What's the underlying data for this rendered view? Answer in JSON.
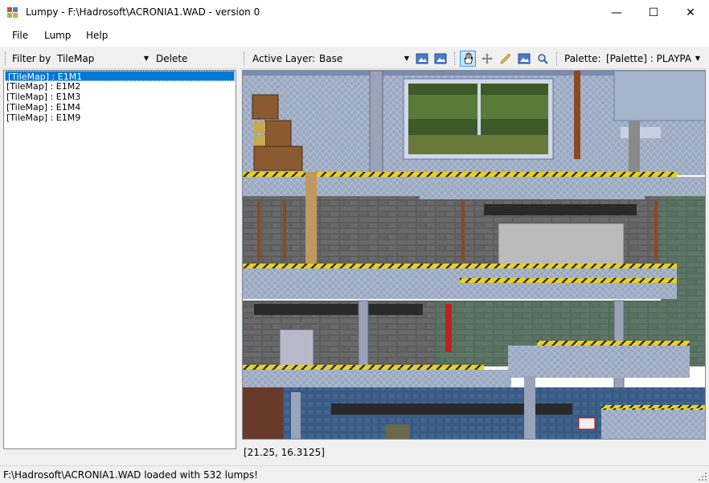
{
  "window": {
    "title": "Lumpy - F:\\Hadrosoft\\ACRONIA1.WAD - version 0",
    "minimize_glyph": "—",
    "maximize_glyph": "☐",
    "close_glyph": "✕"
  },
  "menu": {
    "items": [
      "File",
      "Lump",
      "Help"
    ]
  },
  "filter": {
    "label": "Filter by",
    "value": "TileMap",
    "delete_label": "Delete"
  },
  "lumps": [
    {
      "label": "[TileMap] : E1M1",
      "selected": true
    },
    {
      "label": "[TileMap] : E1M2",
      "selected": false
    },
    {
      "label": "[TileMap] : E1M3",
      "selected": false
    },
    {
      "label": "[TileMap] : E1M4",
      "selected": false
    },
    {
      "label": "[TileMap] : E1M9",
      "selected": false
    }
  ],
  "editor": {
    "active_layer_label": "Active Layer:",
    "active_layer_value": "Base",
    "palette_label": "Palette:",
    "palette_value": "[Palette] : PLAYPA",
    "cursor_coords": "[21.25, 16.3125]"
  },
  "status": {
    "text": "F:\\Hadrosoft\\ACRONIA1.WAD loaded with 532 lumps!"
  },
  "colors": {
    "selection": "#0078d7",
    "hazard_yellow": "#e8d020",
    "floor_blue": "#8a9ab8",
    "wall_gray": "#5a5a5a"
  }
}
